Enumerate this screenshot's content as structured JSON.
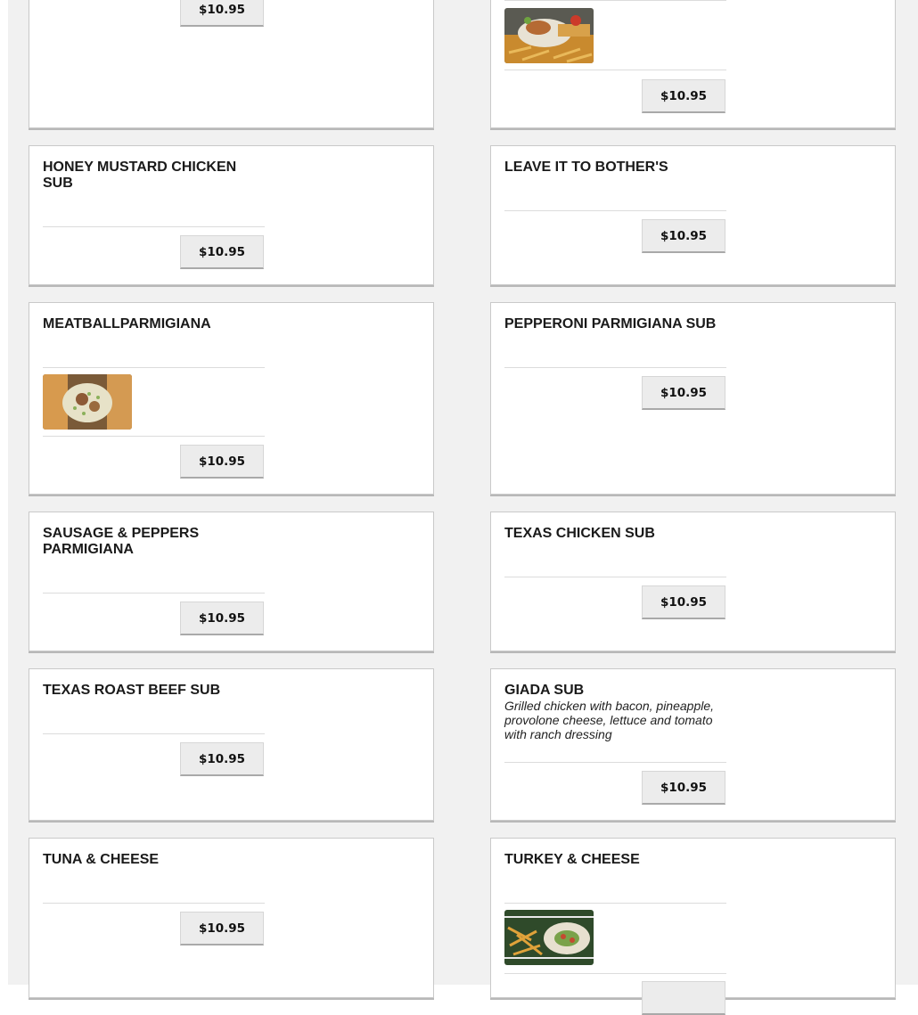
{
  "menu": {
    "currency_price": "$10.95",
    "items": [
      {
        "id": "top-left",
        "title": "",
        "description": "",
        "price": "$10.95"
      },
      {
        "id": "top-right",
        "title": "",
        "description": "",
        "price": "$10.95"
      },
      {
        "id": "honey-mustard",
        "title": "HONEY MUSTARD CHICKEN SUB",
        "description": "",
        "price": "$10.95"
      },
      {
        "id": "leave-it",
        "title": "LEAVE IT TO BOTHER'S",
        "description": "",
        "price": "$10.95"
      },
      {
        "id": "meatball",
        "title": "MEATBALLPARMIGIANA",
        "description": "",
        "price": "$10.95"
      },
      {
        "id": "pepperoni",
        "title": "PEPPERONI PARMIGIANA SUB",
        "description": "",
        "price": "$10.95"
      },
      {
        "id": "sausage",
        "title": "SAUSAGE & PEPPERS PARMIGIANA",
        "description": "",
        "price": "$10.95"
      },
      {
        "id": "texas-chicken",
        "title": "TEXAS CHICKEN SUB",
        "description": "",
        "price": "$10.95"
      },
      {
        "id": "texas-roast",
        "title": "TEXAS ROAST BEEF SUB",
        "description": "",
        "price": "$10.95"
      },
      {
        "id": "giada",
        "title": "GIADA SUB",
        "description": "Grilled chicken with bacon, pineapple, provolone cheese, lettuce and tomato with ranch dressing",
        "price": "$10.95"
      },
      {
        "id": "tuna",
        "title": "TUNA & CHEESE",
        "description": "",
        "price": "$10.95"
      },
      {
        "id": "turkey",
        "title": "TURKEY & CHEESE",
        "description": "",
        "price": ""
      }
    ]
  },
  "colors": {
    "page_bg": "#f1f1f1",
    "card_bg": "#ffffff",
    "button_bg": "#ececec",
    "text": "#1a1a1a"
  },
  "icons": {
    "photo": "food-photo-icon"
  }
}
